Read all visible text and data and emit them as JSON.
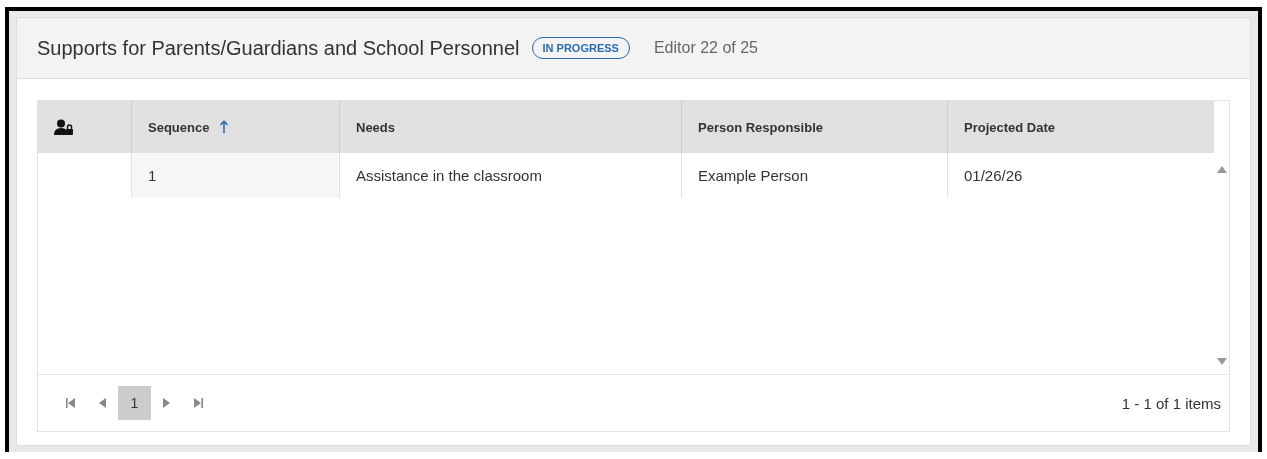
{
  "header": {
    "title": "Supports for Parents/Guardians and School Personnel",
    "status": "IN PROGRESS",
    "editor": "Editor 22 of 25"
  },
  "table": {
    "columns": [
      {
        "kind": "icon",
        "sorted": false
      },
      {
        "kind": "text",
        "label": "Sequence",
        "sorted": true
      },
      {
        "kind": "text",
        "label": "Needs",
        "sorted": false
      },
      {
        "kind": "text",
        "label": "Person Responsible",
        "sorted": false
      },
      {
        "kind": "text",
        "label": "Projected Date",
        "sorted": false
      }
    ],
    "rows": [
      {
        "cells": [
          "",
          "1",
          "Assistance in the classroom",
          "Example Person",
          "01/26/26"
        ]
      }
    ]
  },
  "pager": {
    "pages": [
      {
        "label": "1",
        "selected": true
      }
    ],
    "summary": "1 - 1 of 1 items"
  }
}
